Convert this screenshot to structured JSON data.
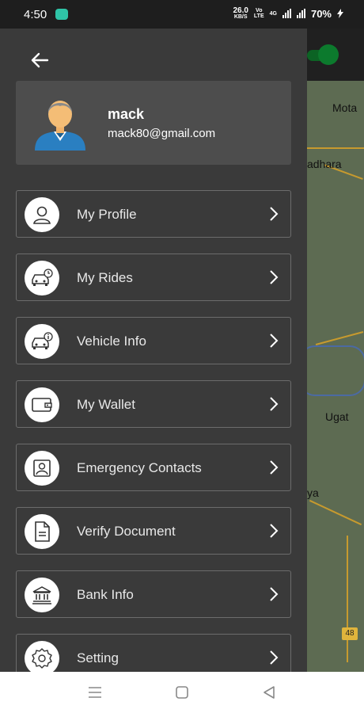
{
  "status_bar": {
    "time": "4:50",
    "speed_value": "26.0",
    "speed_unit": "KB/S",
    "volte_top": "Vo",
    "volte_bottom": "LTE",
    "net1": "4G",
    "battery": "70%"
  },
  "user": {
    "name": "mack",
    "email": "mack80@gmail.com"
  },
  "menu": [
    {
      "label": "My Profile",
      "icon": "user-icon"
    },
    {
      "label": "My Rides",
      "icon": "car-history-icon"
    },
    {
      "label": "Vehicle Info",
      "icon": "car-info-icon"
    },
    {
      "label": "My Wallet",
      "icon": "wallet-icon"
    },
    {
      "label": "Emergency Contacts",
      "icon": "contact-card-icon"
    },
    {
      "label": "Verify Document",
      "icon": "document-icon"
    },
    {
      "label": "Bank Info",
      "icon": "bank-icon"
    },
    {
      "label": "Setting",
      "icon": "gear-icon"
    }
  ],
  "map": {
    "labels": [
      "Mota",
      "adhara",
      "Ugat",
      "ya"
    ],
    "highway": "48"
  },
  "colors": {
    "drawer": "#3a3a3a",
    "card": "#4d4d4d",
    "accent_green": "#0c7a2d"
  }
}
